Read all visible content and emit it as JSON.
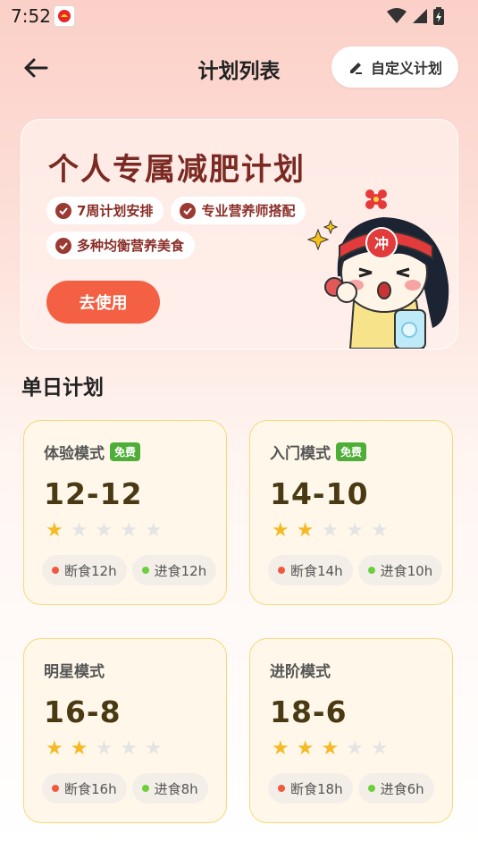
{
  "status": {
    "time": "7:52"
  },
  "nav": {
    "title": "计划列表",
    "custom_label": "自定义计划"
  },
  "banner": {
    "title": "个人专属减肥计划",
    "tags": [
      "7周计划安排",
      "专业营养师搭配",
      "多种均衡营养美食"
    ],
    "button": "去使用",
    "illustration_badge": "冲"
  },
  "section": {
    "title": "单日计划"
  },
  "colors": {
    "accent": "#f36043",
    "free_badge": "#4fae37",
    "star_on": "#f5b926",
    "fast_dot": "#ef5a3f",
    "eat_dot": "#6ccf3e"
  },
  "plans": [
    {
      "name": "体验模式",
      "badge": "免费",
      "ratio": "12-12",
      "stars": 1,
      "max_stars": 5,
      "fast": "断食12h",
      "eat": "进食12h"
    },
    {
      "name": "入门模式",
      "badge": "免费",
      "ratio": "14-10",
      "stars": 2,
      "max_stars": 5,
      "fast": "断食14h",
      "eat": "进食10h"
    },
    {
      "name": "明星模式",
      "badge": "",
      "ratio": "16-8",
      "stars": 2,
      "max_stars": 5,
      "fast": "断食16h",
      "eat": "进食8h"
    },
    {
      "name": "进阶模式",
      "badge": "",
      "ratio": "18-6",
      "stars": 3,
      "max_stars": 5,
      "fast": "断食18h",
      "eat": "进食6h"
    }
  ]
}
